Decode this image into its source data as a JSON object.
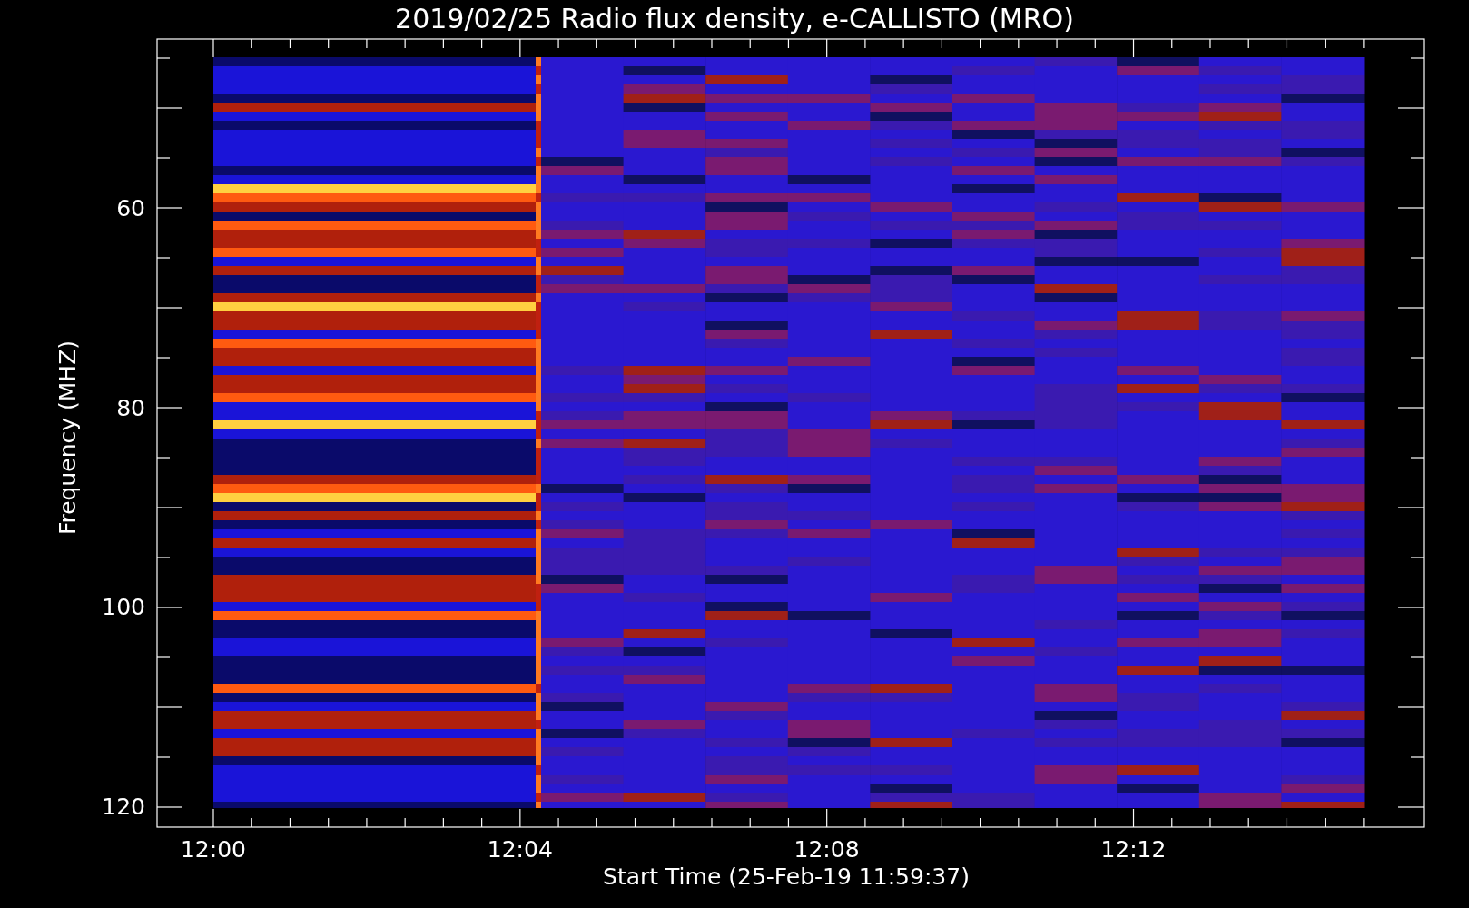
{
  "title": "2019/02/25  Radio flux density, e-CALLISTO (MRO)",
  "y_axis": {
    "label": "Frequency (MHZ)",
    "ticks": [
      "60",
      "80",
      "100",
      "120"
    ]
  },
  "x_axis": {
    "label": "Start Time (25-Feb-19 11:59:37)",
    "ticks": [
      "12:00",
      "12:04",
      "12:08",
      "12:12"
    ]
  }
}
